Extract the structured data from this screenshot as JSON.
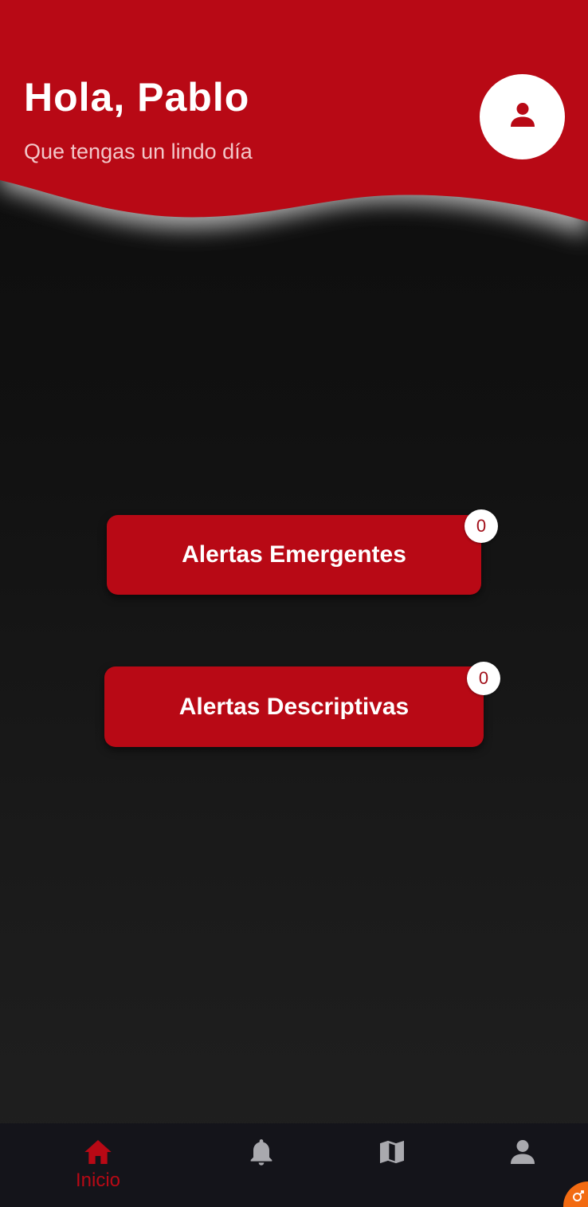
{
  "header": {
    "greeting": "Hola, Pablo",
    "subtitle": "Que tengas un lindo día",
    "avatar_icon": "person-icon"
  },
  "alerts": {
    "emergentes": {
      "label": "Alertas Emergentes",
      "count": "0"
    },
    "descriptivas": {
      "label": "Alertas Descriptivas",
      "count": "0"
    }
  },
  "bottom_nav": {
    "items": [
      {
        "label": "Inicio",
        "icon": "home-icon",
        "active": true
      },
      {
        "label": "",
        "icon": "bell-icon",
        "active": false
      },
      {
        "label": "",
        "icon": "map-icon",
        "active": false
      },
      {
        "label": "",
        "icon": "person-icon",
        "active": false
      }
    ]
  },
  "colors": {
    "primary": "#b80915",
    "background": "#111111",
    "nav_background": "#14141a",
    "inactive_icon": "#a9a9ae",
    "fab": "#f26b12"
  }
}
